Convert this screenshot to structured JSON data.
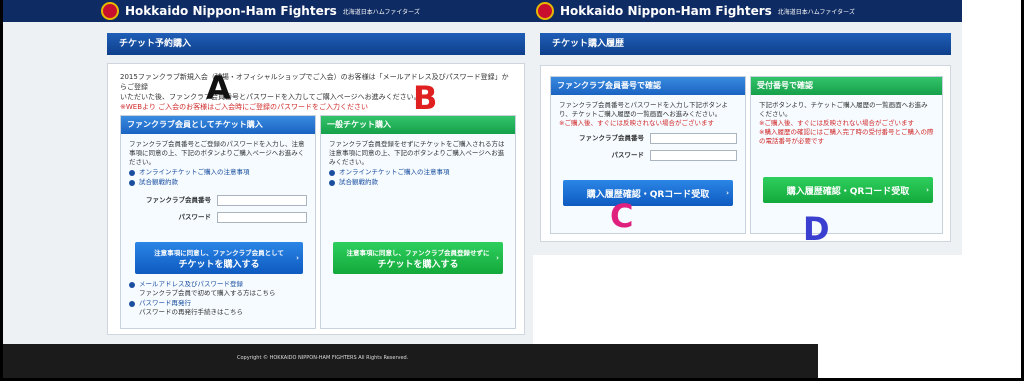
{
  "left_page": {
    "brand": {
      "name_en": "Hokkaido Nippon-Ham Fighters",
      "name_jp": "北海道日本ハムファイターズ"
    },
    "section_title": "チケット予約購入",
    "intro": {
      "line1": "2015ファンクラブ新規入会（球場・オフィシャルショップでご入会）のお客様は「メールアドレス及びパスワード登録」からご登録",
      "line2": "いただいた後、ファンクラブ会員番号とパスワードを入力してご購入ページへお進みください。",
      "note": "※WEBより ご入会のお客様はご入会時にご登録のパスワードをご入力ください"
    },
    "member_card": {
      "header": "ファンクラブ会員としてチケット購入",
      "desc": "ファンクラブ会員番号とご登録のパスワードを入力し、注意事項に同意の上、下記のボタンよりご購入ページへお進みください。",
      "link1": "オンラインチケットご購入の注意事項",
      "link2": "試合観戦約款",
      "label_member_no": "ファンクラブ会員番号",
      "label_password": "パスワード",
      "button_line1": "注意事項に同意し、ファンクラブ会員として",
      "button_line2": "チケットを購入する",
      "link3": "メールアドレス及びパスワード登録",
      "link3_sub": "ファンクラブ会員で初めて購入する方はこちら",
      "link4": "パスワード再発行",
      "link4_sub": "パスワードの再発行手続きはこちら"
    },
    "general_card": {
      "header": "一般チケット購入",
      "desc": "ファンクラブ会員登録をせずにチケットをご購入される方は注意事項に同意の上、下記のボタンよりご購入ページへお進みください。",
      "link1": "オンラインチケットご購入の注意事項",
      "link2": "試合観戦約款",
      "button_line1": "注意事項に同意し、ファンクラブ会員登録せずに",
      "button_line2": "チケットを購入する"
    },
    "footer": "Copyright © HOKKAIDO NIPPON-HAM FIGHTERS All Rights Reserved."
  },
  "right_page": {
    "brand": {
      "name_en": "Hokkaido Nippon-Ham Fighters",
      "name_jp": "北海道日本ハムファイターズ"
    },
    "section_title": "チケット購入履歴",
    "member_card": {
      "header": "ファンクラブ会員番号で確認",
      "desc": "ファンクラブ会員番号とパスワードを入力し下記ボタンより、チケットご購入履歴の一覧画面へお進みください。",
      "note": "※ご購入後、すぐには反映されない場合がございます",
      "label_member_no": "ファンクラブ会員番号",
      "label_password": "パスワード",
      "button": "購入履歴確認・QRコード受取"
    },
    "receipt_card": {
      "header": "受付番号で確認",
      "desc": "下記ボタンより、チケットご購入履歴の一覧画面へお進みください。",
      "note1": "※ご購入後、すぐには反映されない場合がございます",
      "note2": "※購入履歴の確認にはご購入完了時の受付番号とご購入の際の電話番号が必要です",
      "button": "購入履歴確認・QRコード受取"
    }
  },
  "markers": {
    "a": "A",
    "b": "B",
    "c": "C",
    "d": "D"
  },
  "colors": {
    "nav": "#0f2b63",
    "blue": "#1a63c2",
    "green": "#15a04a",
    "red": "#d12a2a",
    "marker_c": "#e0207f",
    "marker_d": "#3b3fd0"
  }
}
